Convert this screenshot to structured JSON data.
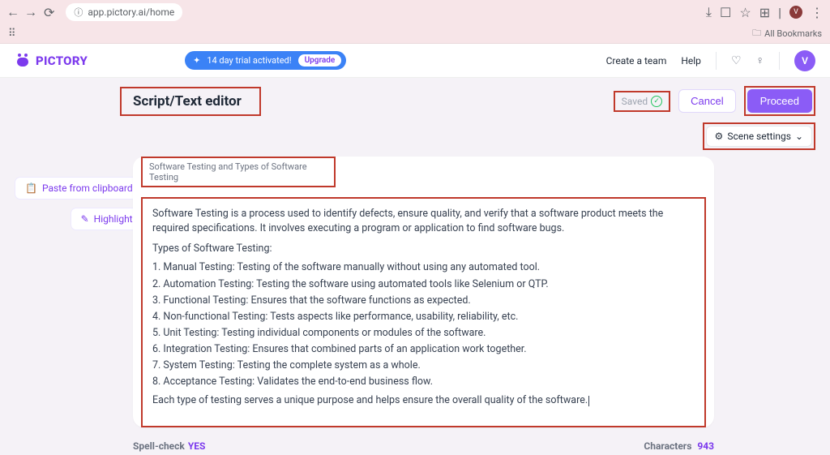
{
  "browser": {
    "url": "app.pictory.ai/home",
    "all_bookmarks": "All Bookmarks"
  },
  "header": {
    "brand": "PICTORY",
    "trial_text": "14 day trial activated!",
    "upgrade": "Upgrade",
    "create_team": "Create a team",
    "help": "Help",
    "avatar_letter": "V"
  },
  "page": {
    "title": "Script/Text editor",
    "saved": "Saved",
    "cancel": "Cancel",
    "proceed": "Proceed",
    "scene_settings": "Scene settings"
  },
  "tools": {
    "paste": "Paste from clipboard",
    "highlight": "Highlight"
  },
  "editor": {
    "doc_title": "Software Testing and Types of Software Testing",
    "intro": "Software Testing is a process used to identify defects, ensure quality, and verify that a software product meets the required specifications. It involves executing a program or application to find software bugs.",
    "types_heading": "Types of Software Testing:",
    "items": [
      "1. Manual Testing: Testing of the software manually without using any automated tool.",
      "2. Automation Testing: Testing the software using automated tools like Selenium or QTP.",
      "3. Functional Testing: Ensures that the software functions as expected.",
      "4. Non-functional Testing: Tests aspects like performance, usability, reliability, etc.",
      "5. Unit Testing: Testing individual components or modules of the software.",
      "6. Integration Testing: Ensures that combined parts of an application work together.",
      "7. System Testing: Testing the complete system as a whole.",
      "8. Acceptance Testing: Validates the end-to-end business flow."
    ],
    "outro": "Each type of testing serves a unique purpose and helps ensure the overall quality of the software."
  },
  "footer": {
    "spell_label": "Spell-check",
    "spell_value": "YES",
    "chars_label": "Characters",
    "chars_value": "943"
  }
}
